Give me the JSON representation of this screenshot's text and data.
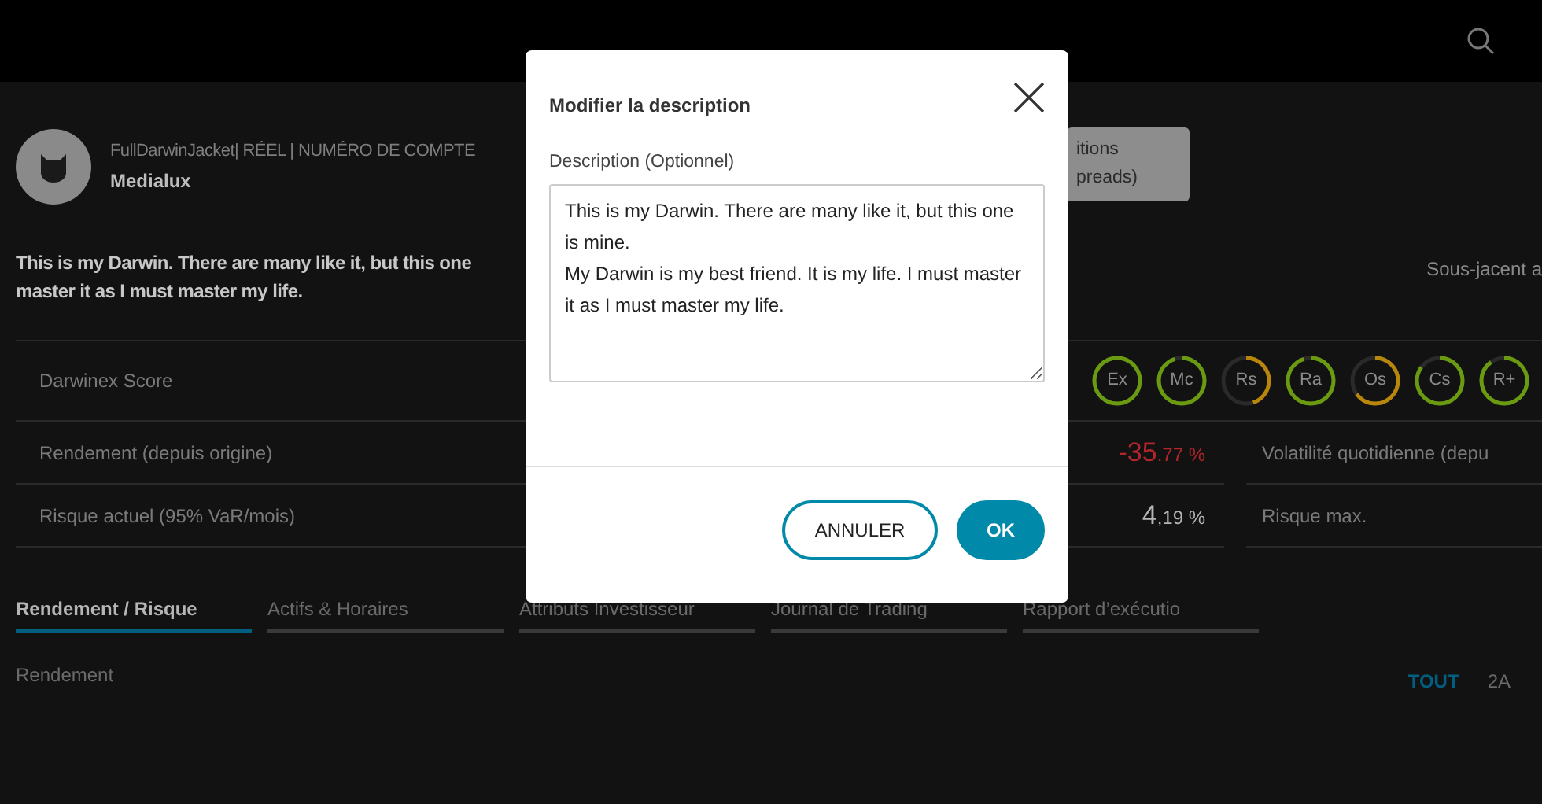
{
  "profile": {
    "account_line": "FullDarwinJacket| RÉEL | NUMÉRO DE COMPTE",
    "name": "Medialux"
  },
  "side_button": {
    "lines": [
      "itions",
      "preads)"
    ]
  },
  "description_lines": [
    "This is my Darwin. There are many like it, but this one",
    "master it as I must master my life."
  ],
  "underlying": "Sous-jacent a",
  "score_label": "Darwinex Score",
  "scores": [
    {
      "label": "Ex",
      "level": 1,
      "color": "#6a9a10"
    },
    {
      "label": "Mc",
      "level": 0.95,
      "color": "#6a9a10"
    },
    {
      "label": "Rs",
      "level": 0.45,
      "color": "#b8860b"
    },
    {
      "label": "Ra",
      "level": 0.95,
      "color": "#6a9a10"
    },
    {
      "label": "Os",
      "level": 0.65,
      "color": "#b8860b"
    },
    {
      "label": "Cs",
      "level": 0.85,
      "color": "#6a9a10"
    },
    {
      "label": "R+",
      "level": 0.9,
      "color": "#6a9a10"
    }
  ],
  "metrics": [
    {
      "label": "Rendement (depuis origine)",
      "whole": "-35",
      "fraction": ".77 %",
      "color": "#b0262a",
      "side_label": "Volatilité quotidienne (depu"
    },
    {
      "label": "Risque actuel (95% VaR/mois)",
      "whole": "4",
      "fraction": ",19 %",
      "color": "#b5b5b5",
      "side_label": "Risque max."
    }
  ],
  "tabs": [
    {
      "label": "Rendement / Risque",
      "selected": true
    },
    {
      "label": "Actifs & Horaires",
      "selected": false
    },
    {
      "label": "Attributs Investisseur",
      "selected": false
    },
    {
      "label": "Journal de Trading",
      "selected": false
    },
    {
      "label": "Rapport d’exécutio",
      "selected": false
    }
  ],
  "chart_section": {
    "title": "Rendement",
    "ranges": [
      {
        "label": "TOUT",
        "selected": true
      },
      {
        "label": "2A",
        "selected": false
      }
    ]
  },
  "dialog": {
    "title": "Modifier la description",
    "field_label": "Description (Optionnel)",
    "value": "This is my Darwin. There are many like it, but this one is mine.\nMy Darwin is my best friend. It is my life. I must master it as I must master my life.",
    "buttons": [
      {
        "label": "ANNULER",
        "kind": "secondary"
      },
      {
        "label": "OK",
        "kind": "primary"
      }
    ]
  }
}
